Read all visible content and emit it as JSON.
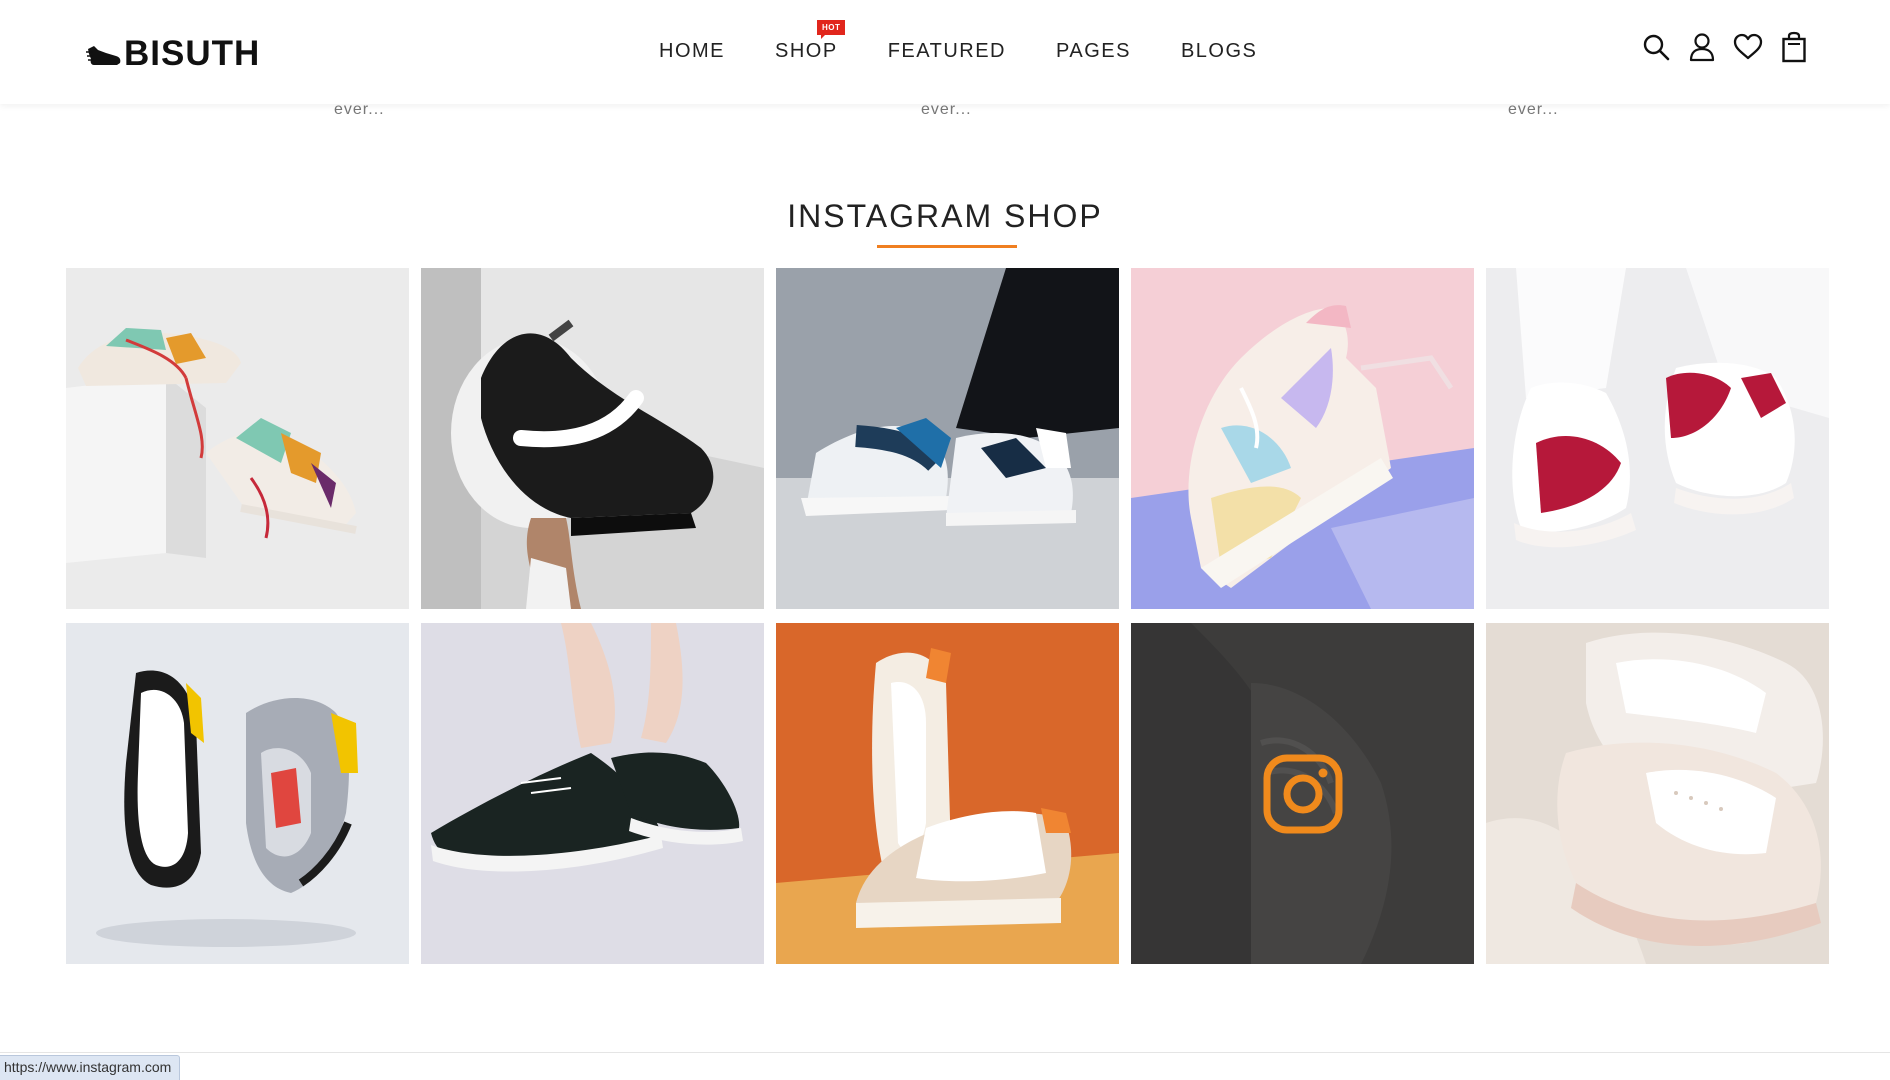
{
  "header": {
    "logo_text": "BISUTH",
    "nav": [
      {
        "label": "HOME"
      },
      {
        "label": "SHOP",
        "badge": "HOT"
      },
      {
        "label": "FEATURED"
      },
      {
        "label": "PAGES"
      },
      {
        "label": "BLOGS"
      }
    ],
    "icons": [
      "search-icon",
      "user-icon",
      "heart-icon",
      "shopping-bag-icon"
    ]
  },
  "excerpts": [
    "ever...",
    "ever...",
    "ever..."
  ],
  "instagram": {
    "title": "INSTAGRAM SHOP",
    "accent_color": "#f07f20",
    "tiles": [
      {
        "alt": "colorful sneakers on white block"
      },
      {
        "alt": "hand holding black sneaker"
      },
      {
        "alt": "person wearing blue high-top sneakers"
      },
      {
        "alt": "pastel sneaker on pink background"
      },
      {
        "alt": "red and white sneakers with white trousers"
      },
      {
        "alt": "two running shoes floating"
      },
      {
        "alt": "black running shoe on foot"
      },
      {
        "alt": "beige sneakers on orange background"
      },
      {
        "alt": "dark tile with instagram icon",
        "hovered": true
      },
      {
        "alt": "close-up of white leather sneakers"
      }
    ]
  },
  "status_bar": {
    "url": "https://www.instagram.com"
  }
}
